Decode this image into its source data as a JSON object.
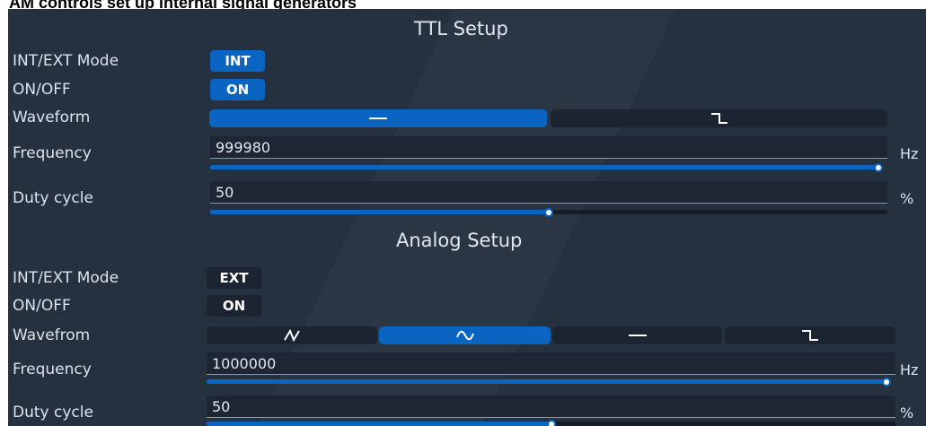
{
  "caption": "AM controls set up internal signal generators",
  "ttl": {
    "title": "TTL Setup",
    "mode_label": "INT/EXT Mode",
    "mode_value": "INT",
    "onoff_label": "ON/OFF",
    "onoff_value": "ON",
    "waveform_label": "Waveform",
    "waveform_options": [
      "dc-line-icon",
      "square-step-icon"
    ],
    "waveform_selected": 0,
    "frequency_label": "Frequency",
    "frequency_value": "999980",
    "frequency_unit": "Hz",
    "frequency_slider_fraction": 1.0,
    "duty_label": "Duty cycle",
    "duty_value": "50",
    "duty_unit": "%",
    "duty_slider_fraction": 0.5
  },
  "analog": {
    "title": "Analog Setup",
    "mode_label": "INT/EXT Mode",
    "mode_value": "EXT",
    "onoff_label": "ON/OFF",
    "onoff_value": "ON",
    "waveform_label": "Wavefrom",
    "waveform_options": [
      "triangle-wave-icon",
      "sine-wave-icon",
      "dc-line-icon",
      "square-step-icon"
    ],
    "waveform_selected": 1,
    "frequency_label": "Frequency",
    "frequency_value": "1000000",
    "frequency_unit": "Hz",
    "frequency_slider_fraction": 1.0,
    "duty_label": "Duty cycle",
    "duty_value": "50",
    "duty_unit": "%",
    "duty_slider_fraction": 0.5
  },
  "colors": {
    "panel_bg": "#263140",
    "accent": "#0a64c2",
    "dark_control": "#1b2430"
  }
}
